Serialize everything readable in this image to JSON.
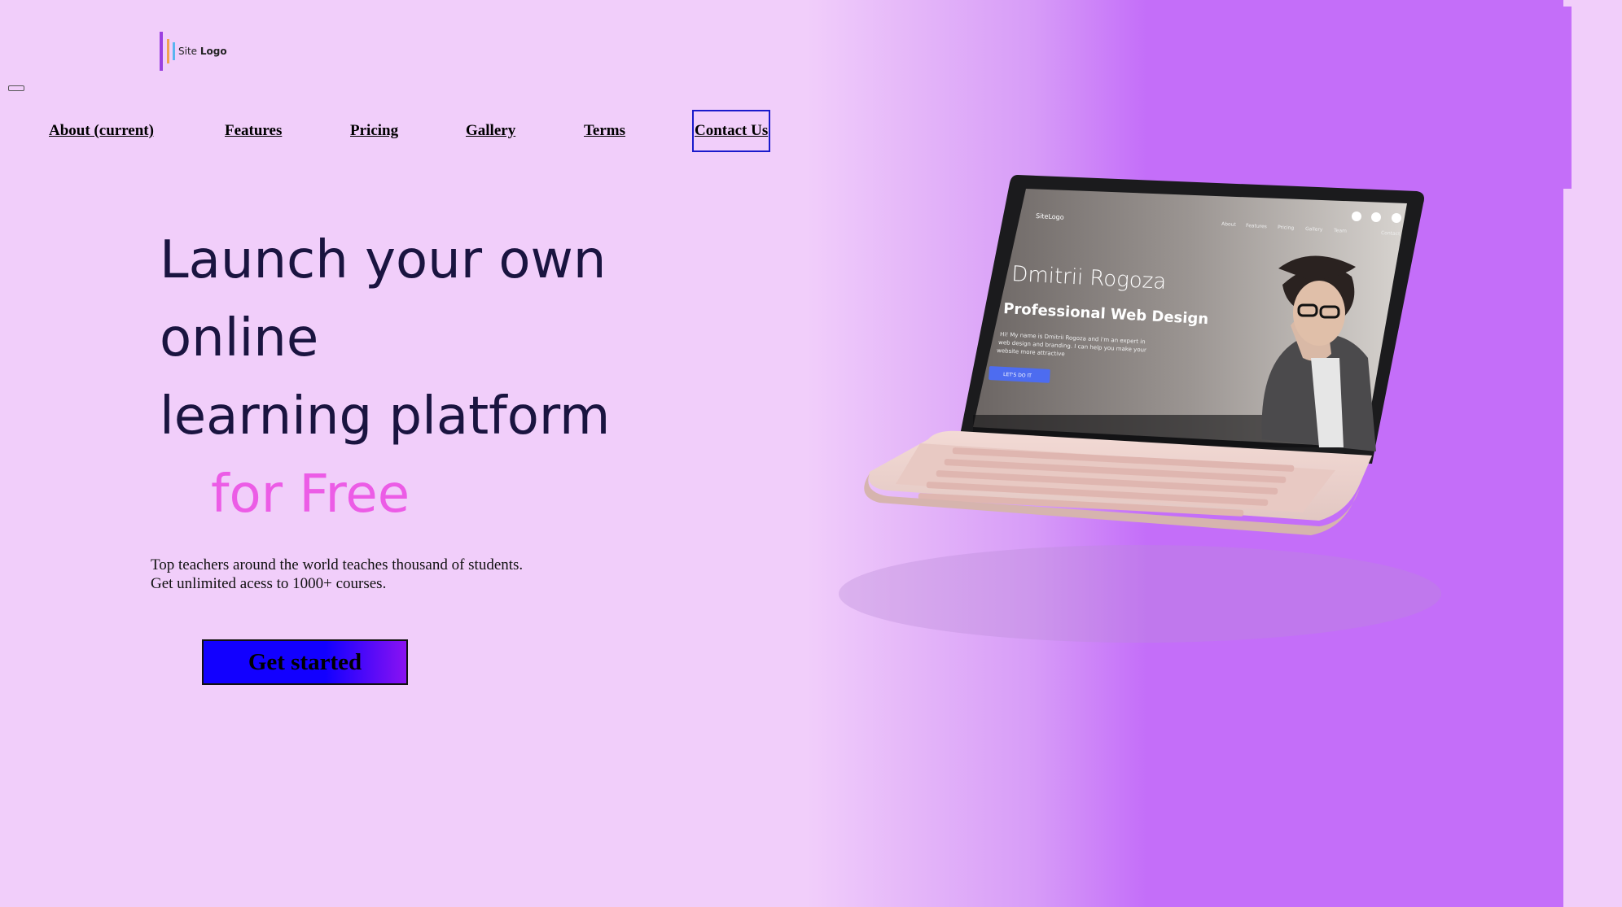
{
  "logo": {
    "text_light": "Site ",
    "text_bold": "Logo"
  },
  "nav": {
    "items": [
      {
        "label": "About (current)"
      },
      {
        "label": "Features"
      },
      {
        "label": "Pricing"
      },
      {
        "label": "Gallery"
      },
      {
        "label": "Terms"
      },
      {
        "label": "Contact Us"
      }
    ]
  },
  "hero": {
    "title_lines": [
      "Launch your own",
      "online",
      "learning platform"
    ],
    "title_accent": "for Free",
    "subtitle_lines": [
      "Top teachers around the world teaches thousand of students.",
      "Get unlimited acess to 1000+ courses."
    ],
    "cta_label": "Get started"
  },
  "laptop_screen": {
    "logo": "SiteLogo",
    "nav": [
      "About",
      "Features",
      "Pricing",
      "Gallery",
      "Team",
      "Contact"
    ],
    "name": "Dmitrii Rogoza",
    "headline": "Professional Web Design",
    "body_lines": [
      "Hi! My name is Dmitrii Rogoza and i'm an expert in",
      "web design and branding. I can help you make your",
      "website more attractive"
    ],
    "button": "LET'S DO IT"
  },
  "colors": {
    "page_bg": "#f1cefa",
    "gradient_end": "#c46ef9",
    "heading": "#1a1440",
    "accent": "#ec5ce6",
    "cta_start": "#1200ff",
    "cta_end": "#8a12f2",
    "nav_active_border": "#1a1acc"
  }
}
